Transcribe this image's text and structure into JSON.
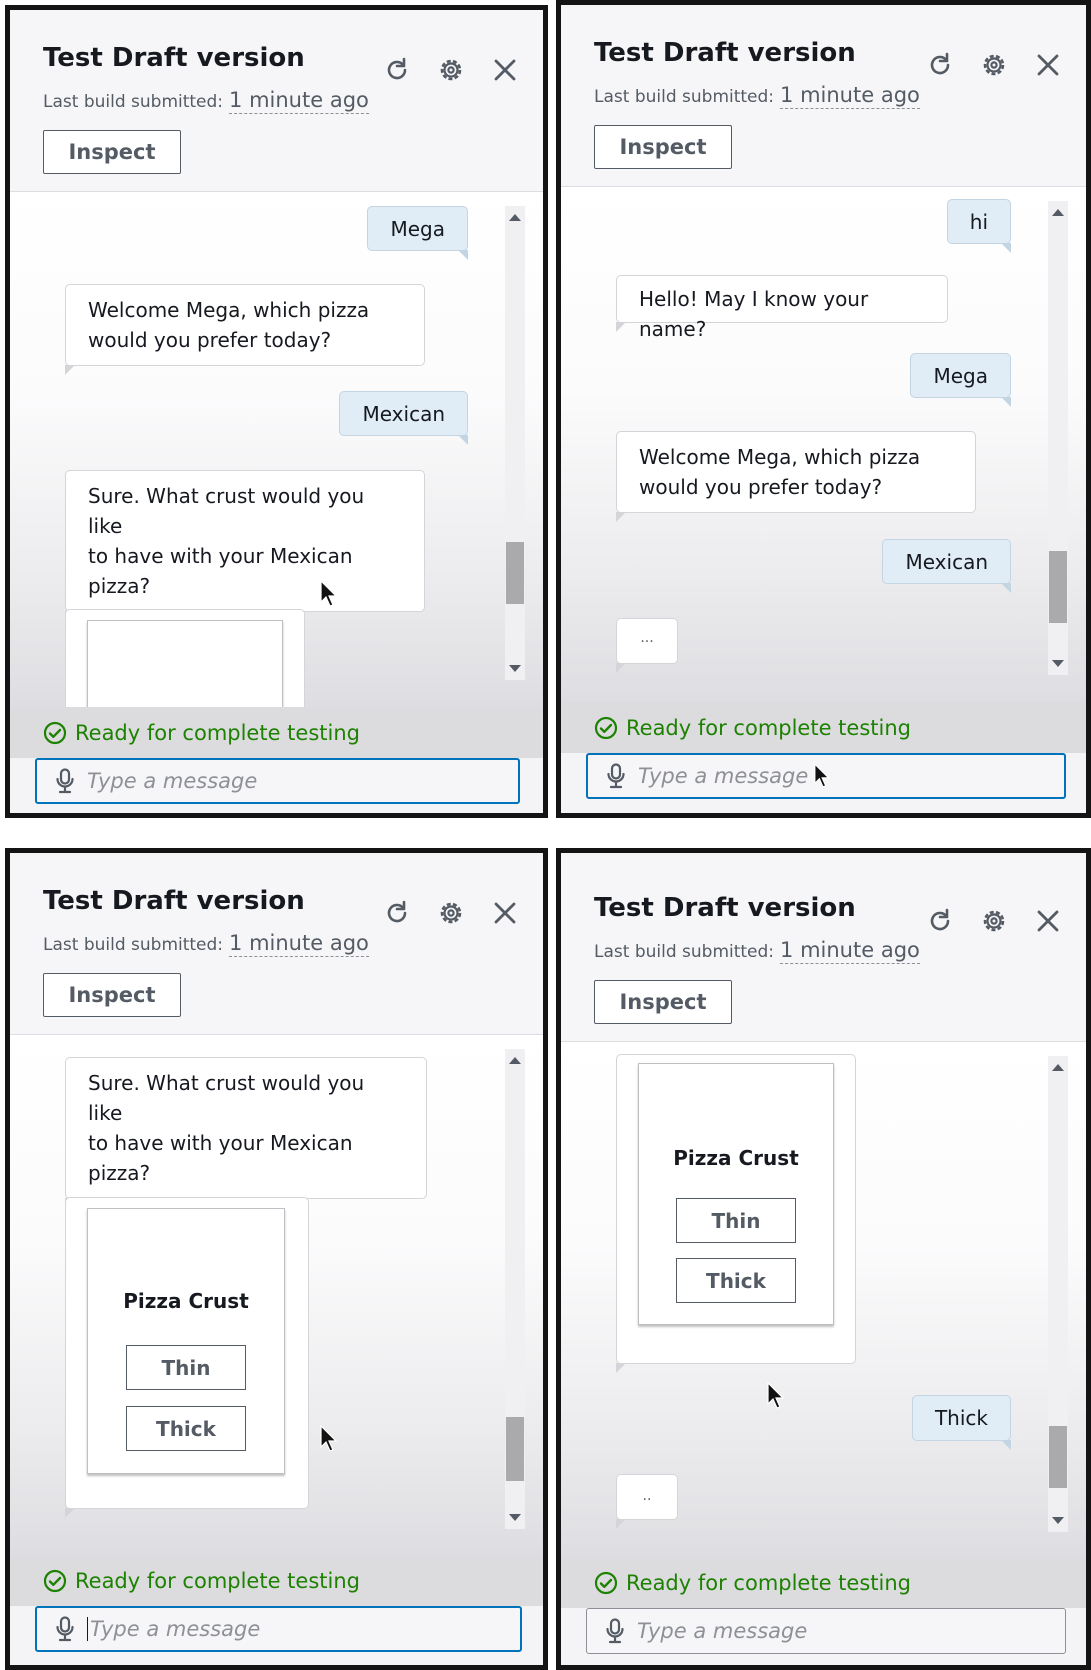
{
  "header": {
    "title": "Test Draft version",
    "last_build_label": "Last build submitted:",
    "last_build_value": "1 minute ago",
    "inspect_label": "Inspect"
  },
  "status": {
    "text": "Ready for complete testing",
    "icon": "check-circle-icon",
    "color": "#1d8102"
  },
  "input": {
    "placeholder": "Type a message",
    "icon": "microphone-icon"
  },
  "header_icons": [
    "refresh-icon",
    "settings-icon",
    "close-icon"
  ],
  "panels": [
    {
      "messages": [
        {
          "type": "user",
          "text": "Mega"
        },
        {
          "type": "bot",
          "lines": [
            "Welcome Mega, which pizza",
            "would you prefer today?"
          ]
        },
        {
          "type": "user",
          "text": "Mexican"
        },
        {
          "type": "bot",
          "lines": [
            "Sure. What crust would you like",
            "to have with your Mexican",
            "pizza?"
          ]
        }
      ]
    },
    {
      "messages": [
        {
          "type": "user",
          "text": "hi"
        },
        {
          "type": "bot",
          "lines": [
            "Hello! May I know your name?"
          ]
        },
        {
          "type": "user",
          "text": "Mega"
        },
        {
          "type": "bot",
          "lines": [
            "Welcome Mega, which pizza",
            "would you prefer today?"
          ]
        },
        {
          "type": "user",
          "text": "Mexican"
        },
        {
          "type": "typing",
          "text": "..."
        }
      ]
    },
    {
      "messages": [
        {
          "type": "bot",
          "lines": [
            "Sure. What crust would you like",
            "to have with your Mexican",
            "pizza?"
          ]
        },
        {
          "type": "card",
          "title": "Pizza Crust",
          "buttons": [
            "Thin",
            "Thick"
          ]
        }
      ]
    },
    {
      "messages": [
        {
          "type": "card",
          "title": "Pizza Crust",
          "buttons": [
            "Thin",
            "Thick"
          ]
        },
        {
          "type": "user",
          "text": "Thick"
        },
        {
          "type": "typing",
          "text": ".."
        }
      ]
    }
  ],
  "colors": {
    "accent": "#0073bb",
    "user_bubble": "#e0ecf6",
    "ready_green": "#1d8102"
  }
}
